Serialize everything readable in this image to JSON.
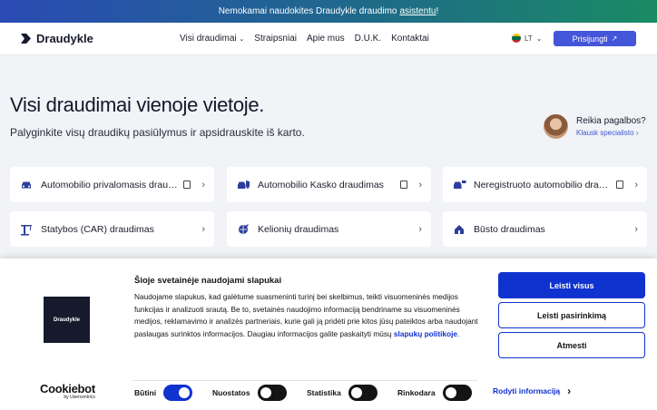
{
  "topbar": {
    "text": "Nemokamai naudokites Draudykle draudimo",
    "link": "asistentu",
    "suffix": "!"
  },
  "header": {
    "logo": "Draudykle",
    "nav": [
      "Visi draudimai",
      "Straipsniai",
      "Apie mus",
      "D.U.K.",
      "Kontaktai"
    ],
    "lang": "LT",
    "login": "Prisijungti"
  },
  "hero": {
    "title": "Visi draudimai vienoje vietoje.",
    "subtitle": "Palyginkite visų draudikų pasiūlymus ir apsidrauskite iš karto."
  },
  "help": {
    "title": "Reikia pagalbos?",
    "link": "Klausk specialisto"
  },
  "cards": [
    {
      "label": "Automobilio privalomasis draudimas",
      "icon": "car-icon"
    },
    {
      "label": "Automobilio Kasko draudimas",
      "icon": "car-shield-icon"
    },
    {
      "label": "Neregistruoto automobilio draudimas",
      "icon": "car-plate-icon"
    },
    {
      "label": "Statybos (CAR) draudimas",
      "icon": "crane-icon"
    },
    {
      "label": "Kelionių draudimas",
      "icon": "globe-plane-icon"
    },
    {
      "label": "Būsto draudimas",
      "icon": "house-icon"
    }
  ],
  "cookie": {
    "logo_text": "Draudykle",
    "title": "Šioje svetainėje naudojami slapukai",
    "body": "Naudojame slapukus, kad galėtume suasmeninti turinį bei skelbimus, teikti visuomeninės medijos funkcijas ir analizuoti srautą. Be to, svetainės naudojimo informaciją bendriname su visuomeninės medijos, reklamavimo ir analizės partneriais, kurie gali ją pridėti prie kitos jūsų pateiktos arba naudojant paslaugas surinktos informacijos. Daugiau informacijos galite paskaityti mūsų",
    "policy_link": "slapukų politikoje",
    "policy_end": ".",
    "allow_all": "Leisti visus",
    "allow_selection": "Leisti pasirinkimą",
    "reject": "Atmesti",
    "brand": "Cookiebot",
    "brand_sub": "by Usercentrics",
    "toggles": [
      {
        "label": "Būtini",
        "on": true
      },
      {
        "label": "Nuostatos",
        "on": false
      },
      {
        "label": "Statistika",
        "on": false
      },
      {
        "label": "Rinkodara",
        "on": false
      }
    ],
    "details": "Rodyti informaciją"
  },
  "colors": {
    "primary": "#1032cf",
    "login": "#4355d8",
    "cookie_logo_bg": "#151b2c"
  }
}
